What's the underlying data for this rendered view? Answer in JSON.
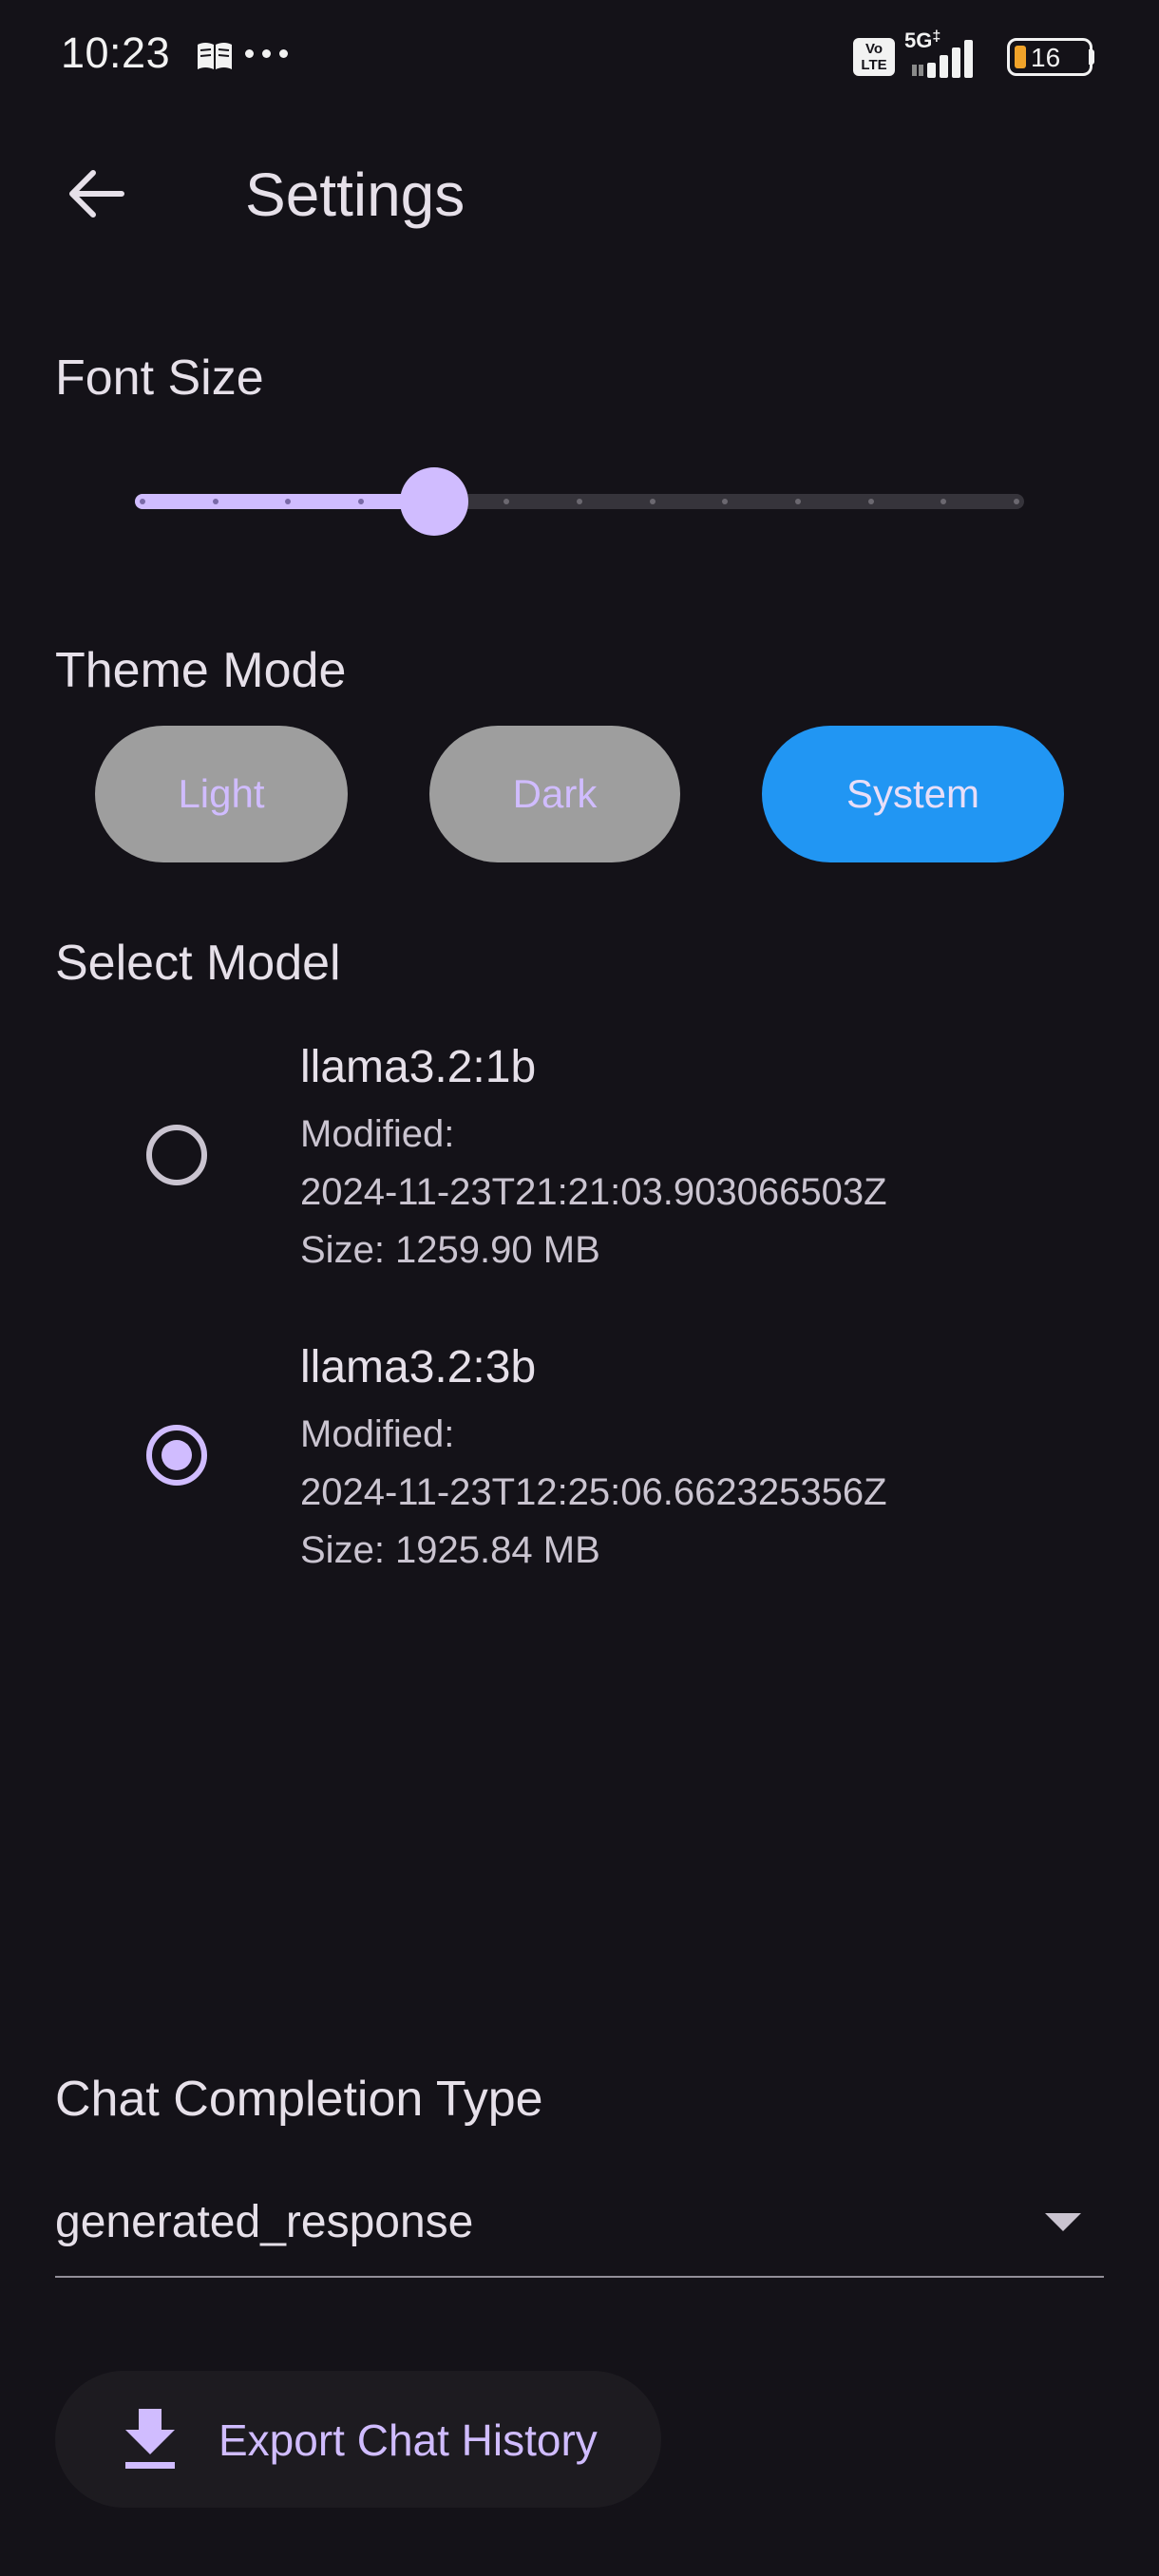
{
  "status_bar": {
    "time": "10:23",
    "network": "5G",
    "volte_label": "Vo\nLTE",
    "battery": "16"
  },
  "app_bar": {
    "title": "Settings",
    "back_icon": "arrow-back-icon"
  },
  "font_size": {
    "label": "Font Size",
    "divisions": 12,
    "value_index": 4
  },
  "theme_mode": {
    "label": "Theme Mode",
    "options": [
      {
        "label": "Light",
        "selected": false
      },
      {
        "label": "Dark",
        "selected": false
      },
      {
        "label": "System",
        "selected": true
      }
    ]
  },
  "select_model": {
    "label": "Select Model",
    "models": [
      {
        "name": "llama3.2:1b",
        "modified_label": "Modified:",
        "modified": "2024-11-23T21:21:03.903066503Z",
        "size": "Size: 1259.90 MB",
        "selected": false
      },
      {
        "name": "llama3.2:3b",
        "modified_label": "Modified:",
        "modified": "2024-11-23T12:25:06.662325356Z",
        "size": "Size: 1925.84 MB",
        "selected": true
      }
    ]
  },
  "chat_completion": {
    "label": "Chat Completion Type",
    "value": "generated_response"
  },
  "export": {
    "label": "Export Chat History",
    "icon": "download-icon"
  },
  "colors": {
    "background": "#141218",
    "accent": "#d0bcff",
    "selected_theme": "#2196f3",
    "inactive_theme": "#9e9e9e"
  }
}
